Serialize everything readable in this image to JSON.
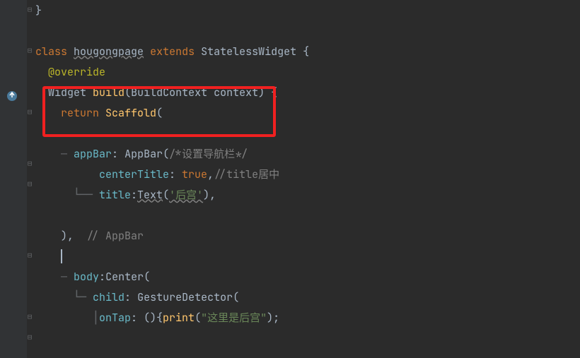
{
  "lines": {
    "l0": [
      "}"
    ],
    "l2_class": "class",
    "l2_name": "hougongpage",
    "l2_extends": "extends",
    "l2_super": "StatelessWidget",
    "l2_brace": " {",
    "l3": "@override",
    "l4_type": "Widget",
    "l4_name": "build",
    "l4_sig_open": "(",
    "l4_param_type": "BuildContext",
    "l4_param_name": " context",
    "l4_sig_close": ") {",
    "l5_return": "return",
    "l5_call": " Scaffold",
    "l5_paren": "(",
    "l7_indent": "    ",
    "l7_tree": "— ",
    "l7_param": "appBar",
    "l7_colon": ": ",
    "l7_call": "AppBar",
    "l7_paren": "(",
    "l7_comment": "/*设置导航栏*/",
    "l8_indent": "          ",
    "l8_param": "centerTitle",
    "l8_colon": ": ",
    "l8_val": "true",
    "l8_comma": ",",
    "l8_comment": "//title居中",
    "l9_indent": "      └── ",
    "l9_param": "title",
    "l9_colon": ":",
    "l9_call": "Text",
    "l9_paren": "(",
    "l9_str": "'后宫'",
    "l9_close": "),",
    "l11_indent": "    ",
    "l11_close": "),",
    "l11_comment": "  // AppBar",
    "l13_indent": "    ",
    "l13_tree": "— ",
    "l13_param": "body",
    "l13_colon": ":",
    "l13_call": "Center",
    "l13_paren": "(",
    "l14_indent": "      ",
    "l14_tree": "└─ ",
    "l14_param": "child",
    "l14_colon": ": ",
    "l14_call": "GestureDetector",
    "l14_paren": "(",
    "l15_indent": "         │",
    "l15_param": "onTap",
    "l15_colon": ": (){",
    "l15_call": "print",
    "l15_paren": "(",
    "l15_str": "\"这里是后宫\"",
    "l15_close": ");"
  },
  "icons": {
    "override": "override-icon"
  }
}
